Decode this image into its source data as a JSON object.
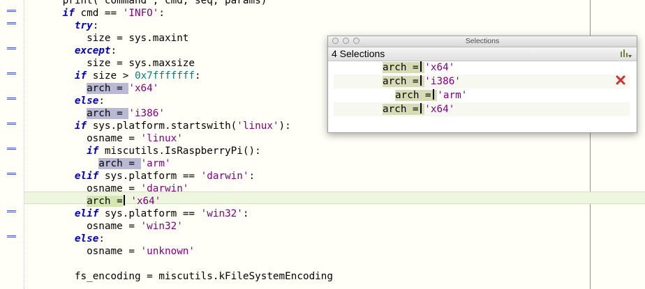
{
  "editor": {
    "lines": [
      {
        "id": "l0",
        "indent": "      ",
        "parts": [
          {
            "t": "print( command , cmd, seq, params)",
            "c": ""
          }
        ]
      },
      {
        "id": "l1",
        "indent": "      ",
        "parts": [
          {
            "t": "if",
            "c": "kw"
          },
          {
            "t": " cmd == ",
            "c": ""
          },
          {
            "t": "'INFO'",
            "c": "str"
          },
          {
            "t": ":",
            "c": ""
          }
        ]
      },
      {
        "id": "l2",
        "indent": "        ",
        "parts": [
          {
            "t": "try",
            "c": "kw"
          },
          {
            "t": ":",
            "c": ""
          }
        ]
      },
      {
        "id": "l3",
        "indent": "          ",
        "parts": [
          {
            "t": "size = sys.maxint",
            "c": ""
          }
        ]
      },
      {
        "id": "l4",
        "indent": "        ",
        "parts": [
          {
            "t": "except",
            "c": "kw"
          },
          {
            "t": ":",
            "c": ""
          }
        ]
      },
      {
        "id": "l5",
        "indent": "          ",
        "parts": [
          {
            "t": "size = sys.maxsize",
            "c": ""
          }
        ]
      },
      {
        "id": "l6",
        "indent": "        ",
        "parts": [
          {
            "t": "if",
            "c": "kw"
          },
          {
            "t": " size > ",
            "c": ""
          },
          {
            "t": "0x7fffffff",
            "c": "num"
          },
          {
            "t": ":",
            "c": ""
          }
        ]
      },
      {
        "id": "l7",
        "indent": "          ",
        "parts": [
          {
            "t": "arch = ",
            "c": "sel"
          },
          {
            "t": "'x64'",
            "c": "str"
          }
        ]
      },
      {
        "id": "l8",
        "indent": "        ",
        "parts": [
          {
            "t": "else",
            "c": "kw"
          },
          {
            "t": ":",
            "c": ""
          }
        ]
      },
      {
        "id": "l9",
        "indent": "          ",
        "parts": [
          {
            "t": "arch = ",
            "c": "sel"
          },
          {
            "t": "'i386'",
            "c": "str"
          }
        ]
      },
      {
        "id": "l10",
        "indent": "        ",
        "parts": [
          {
            "t": "if",
            "c": "kw"
          },
          {
            "t": " sys.platform.startswith(",
            "c": ""
          },
          {
            "t": "'linux'",
            "c": "str"
          },
          {
            "t": "):",
            "c": ""
          }
        ]
      },
      {
        "id": "l11",
        "indent": "          ",
        "parts": [
          {
            "t": "osname = ",
            "c": ""
          },
          {
            "t": "'linux'",
            "c": "str"
          }
        ]
      },
      {
        "id": "l12",
        "indent": "          ",
        "parts": [
          {
            "t": "if",
            "c": "kw"
          },
          {
            "t": " miscutils.IsRaspberryPi():",
            "c": ""
          }
        ]
      },
      {
        "id": "l13",
        "indent": "            ",
        "parts": [
          {
            "t": "arch = ",
            "c": "sel"
          },
          {
            "t": "'arm'",
            "c": "str"
          }
        ]
      },
      {
        "id": "l14",
        "indent": "        ",
        "parts": [
          {
            "t": "elif",
            "c": "kw"
          },
          {
            "t": " sys.platform == ",
            "c": ""
          },
          {
            "t": "'darwin'",
            "c": "str"
          },
          {
            "t": ":",
            "c": ""
          }
        ]
      },
      {
        "id": "l15",
        "indent": "          ",
        "parts": [
          {
            "t": "osname = ",
            "c": ""
          },
          {
            "t": "'darwin'",
            "c": "str"
          }
        ]
      },
      {
        "id": "l16",
        "indent": "          ",
        "parts": [
          {
            "t": "arch =",
            "c": "selc"
          },
          {
            "t": "CURSOR",
            "c": "cursor"
          },
          {
            "t": " ",
            "c": ""
          },
          {
            "t": "'x64'",
            "c": "str"
          }
        ]
      },
      {
        "id": "l17",
        "indent": "        ",
        "parts": [
          {
            "t": "elif",
            "c": "kw"
          },
          {
            "t": " sys.platform == ",
            "c": ""
          },
          {
            "t": "'win32'",
            "c": "str"
          },
          {
            "t": ":",
            "c": ""
          }
        ]
      },
      {
        "id": "l18",
        "indent": "          ",
        "parts": [
          {
            "t": "osname = ",
            "c": ""
          },
          {
            "t": "'win32'",
            "c": "str"
          }
        ]
      },
      {
        "id": "l19",
        "indent": "        ",
        "parts": [
          {
            "t": "else",
            "c": "kw"
          },
          {
            "t": ":",
            "c": ""
          }
        ]
      },
      {
        "id": "l20",
        "indent": "          ",
        "parts": [
          {
            "t": "osname = ",
            "c": ""
          },
          {
            "t": "'unknown'",
            "c": "str"
          }
        ]
      },
      {
        "id": "l21",
        "indent": "",
        "parts": []
      },
      {
        "id": "l22",
        "indent": "        ",
        "parts": [
          {
            "t": "fs_encoding = miscutils.kFileSystemEncoding",
            "c": ""
          }
        ]
      }
    ]
  },
  "panel": {
    "window_title": "Selections",
    "header": "4 Selections",
    "icons": {
      "settings": "settings-icon",
      "remove": "close-icon"
    },
    "rows": [
      {
        "sel": "arch = ",
        "val": "'x64'"
      },
      {
        "sel": "arch = ",
        "val": "'i386'"
      },
      {
        "sel": "arch = ",
        "val": "'arm'"
      },
      {
        "sel": "arch = ",
        "val": "'x64'"
      }
    ]
  },
  "colors": {
    "keyword": "#0000c8",
    "string": "#800080",
    "number": "#008080",
    "selection": "#b9b9d6",
    "current_line": "#eef6e0"
  }
}
